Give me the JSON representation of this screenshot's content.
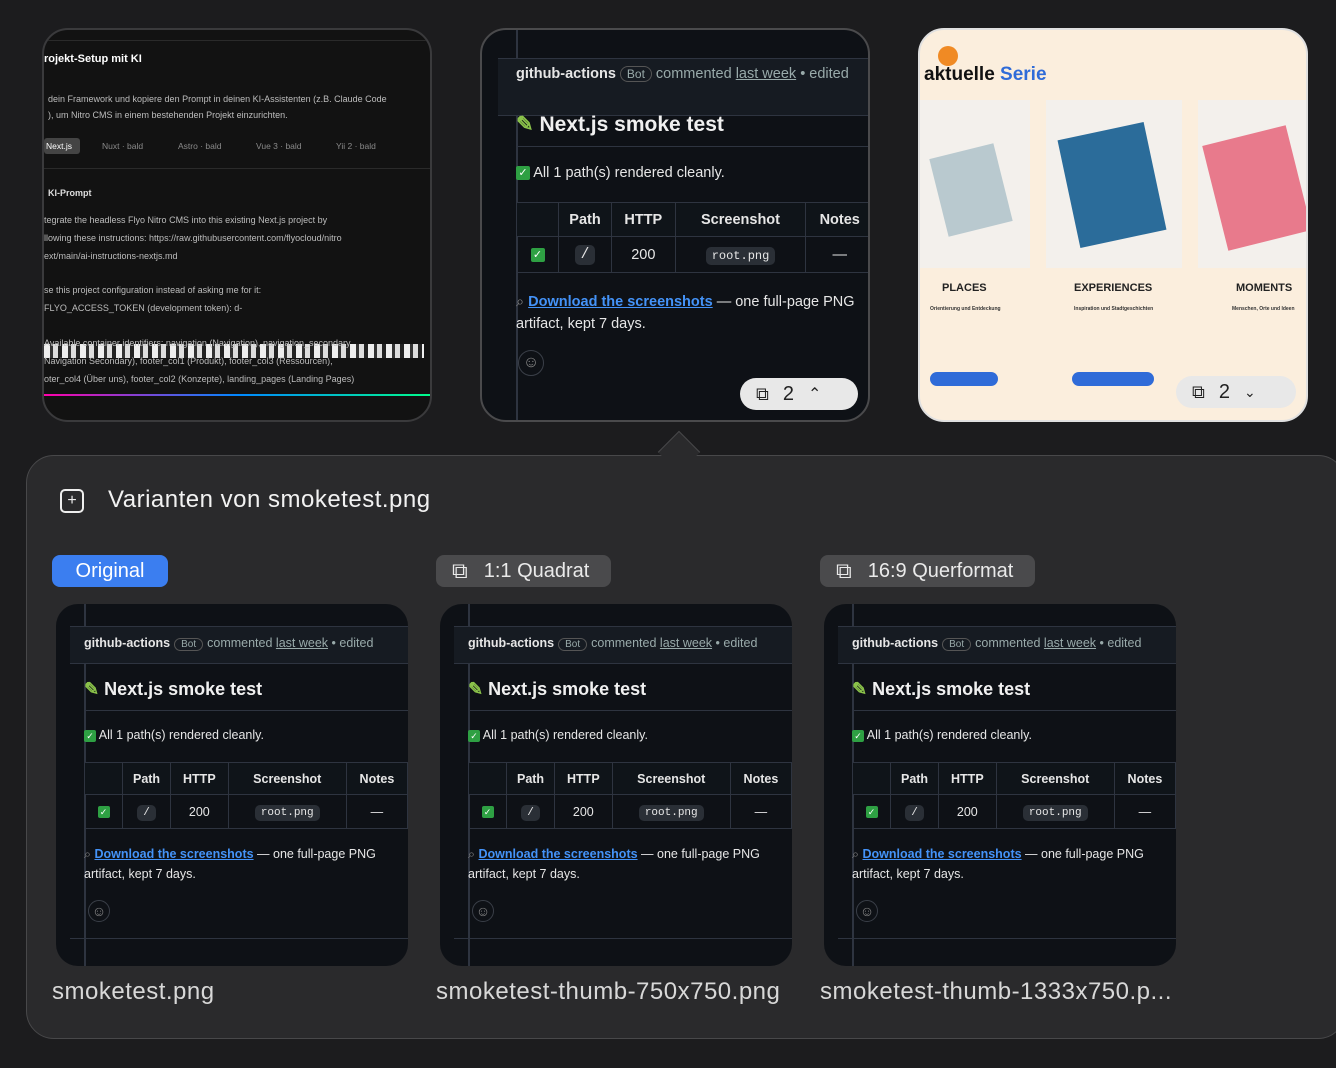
{
  "thumb1": {
    "title": "rojekt-Setup mit KI",
    "line1": "dein Framework und kopiere den Prompt in deinen KI-Assistenten (z.B. Claude Code",
    "line2": "), um Nitro CMS in einem bestehenden Projekt einzurichten.",
    "chips": [
      "Next.js",
      "Nuxt · bald",
      "Astro · bald",
      "Vue 3 · bald",
      "Yii 2 · bald"
    ],
    "prompt_label": "KI-Prompt",
    "p1": "tegrate the headless Flyo Nitro CMS into this existing Next.js project by",
    "p2": "llowing these instructions: https://raw.githubusercontent.com/flyocloud/nitro",
    "p3": "ext/main/ai-instructions-nextjs.md",
    "p4": "se this project configuration instead of asking me for it:",
    "p5": "FLYO_ACCESS_TOKEN (development token): d-",
    "p6": "Available container identifiers: navigation (Navigation), navigation_secondary",
    "p7": "Navigation Secondary), footer_col1 (Produkt), footer_col3 (Ressourcen),",
    "p8": "oter_col4 (Über uns), footer_col2 (Konzepte), landing_pages (Landing Pages)"
  },
  "gh": {
    "author": "github-actions",
    "bot": "Bot",
    "commented": "commented",
    "when": "last week",
    "edited": "• edited",
    "title": "Next.js smoke test",
    "status": "All 1 path(s) rendered cleanly.",
    "headers": [
      "",
      "Path",
      "HTTP",
      "Screenshot",
      "Notes"
    ],
    "row": [
      "✓",
      "/",
      "200",
      "root.png",
      "—"
    ],
    "link": "Download the screenshots",
    "after_link": " — one full-page PNG",
    "artifact": "artifact, kept 7 days."
  },
  "thumb2": {
    "count": "2"
  },
  "thumb3": {
    "heading_a": "aktuelle",
    "heading_b": "Serie",
    "cols": [
      "PLACES",
      "EXPERIENCES",
      "MOMENTS"
    ],
    "subs": [
      "Orientierung und Entdeckung",
      "Inspiration und Stadtgeschichten",
      "Menschen, Orte und Ideen"
    ],
    "count": "2"
  },
  "panel": {
    "title": "Varianten von smoketest.png",
    "variants": [
      {
        "tag": "Original",
        "file": "smoketest.png"
      },
      {
        "tag": "1:1 Quadrat",
        "file": "smoketest-thumb-750x750.png"
      },
      {
        "tag": "16:9 Querformat",
        "file": "smoketest-thumb-1333x750.p..."
      }
    ]
  },
  "colors": {
    "accent": "#3b7ef0",
    "link": "#4493f8",
    "check": "#2ea043",
    "serie": "#2f6bd8"
  }
}
